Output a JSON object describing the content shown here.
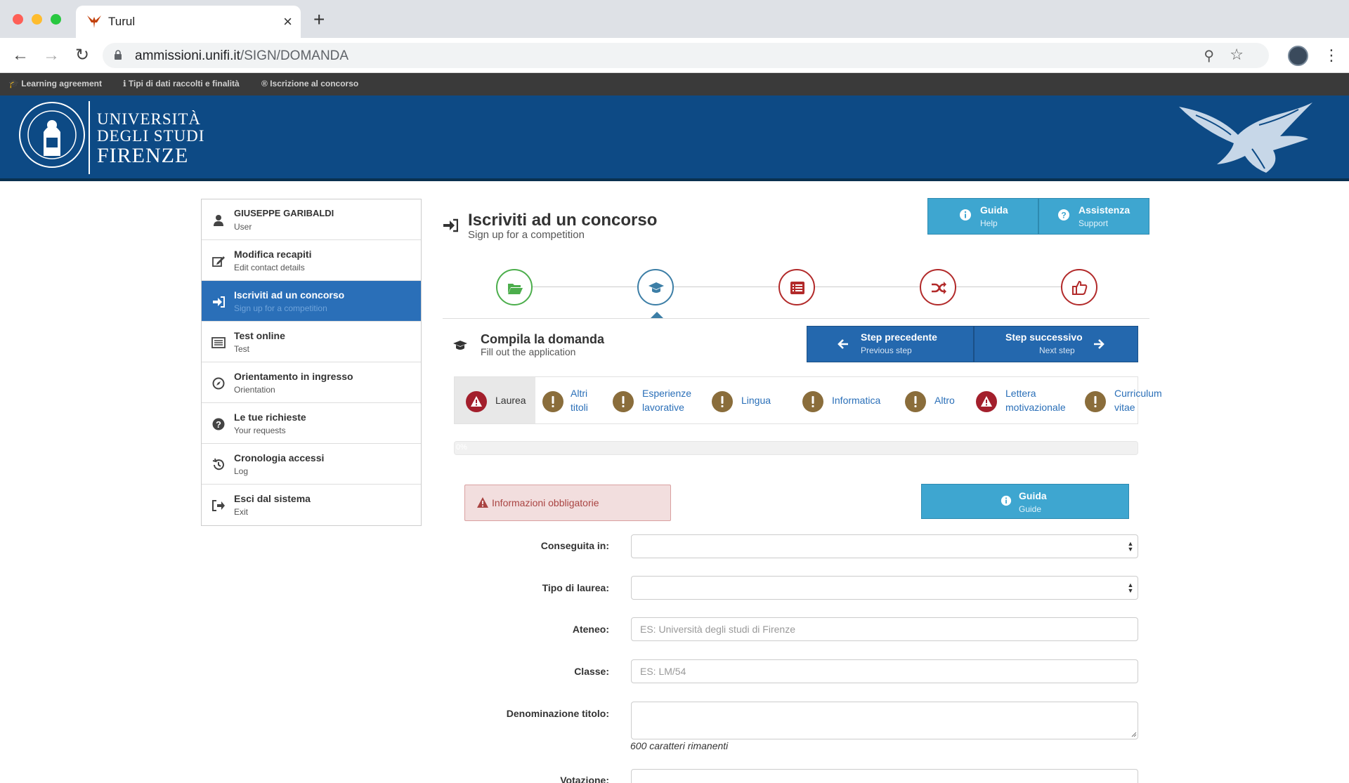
{
  "browser": {
    "tab_title": "Turul",
    "url_host": "ammissioni.unifi.it",
    "url_path": "/SIGN/DOMANDA"
  },
  "topbar": {
    "links": [
      "Learning agreement",
      "Tipi di dati raccolti e finalità",
      "Iscrizione al concorso"
    ]
  },
  "logo": {
    "line1": "UNIVERSITÀ",
    "line2": "DEGLI STUDI",
    "line3": "FIRENZE"
  },
  "sidebar": {
    "items": [
      {
        "title": "GIUSEPPE GARIBALDI",
        "sub": "User",
        "icon": "user-icon"
      },
      {
        "title": "Modifica recapiti",
        "sub": "Edit contact details",
        "icon": "edit-icon"
      },
      {
        "title": "Iscriviti ad un concorso",
        "sub": "Sign up for a competition",
        "icon": "sign-in-icon"
      },
      {
        "title": "Test online",
        "sub": "Test",
        "icon": "list-icon"
      },
      {
        "title": "Orientamento in ingresso",
        "sub": "Orientation",
        "icon": "compass-icon"
      },
      {
        "title": "Le tue richieste",
        "sub": "Your requests",
        "icon": "question-icon"
      },
      {
        "title": "Cronologia accessi",
        "sub": "Log",
        "icon": "history-icon"
      },
      {
        "title": "Esci dal sistema",
        "sub": "Exit",
        "icon": "sign-out-icon"
      }
    ]
  },
  "header": {
    "title": "Iscriviti ad un concorso",
    "subtitle": "Sign up for a competition",
    "help": {
      "title": "Guida",
      "sub": "Help"
    },
    "support": {
      "title": "Assistenza",
      "sub": "Support"
    }
  },
  "steps": [
    {
      "icon": "folder-open-icon",
      "color": "#4cae4c"
    },
    {
      "icon": "graduation-cap-icon",
      "color": "#3c7ea6"
    },
    {
      "icon": "list-icon",
      "color": "#b22a2a"
    },
    {
      "icon": "random-icon",
      "color": "#b22a2a"
    },
    {
      "icon": "thumbs-up-icon",
      "color": "#b22a2a"
    }
  ],
  "section": {
    "title": "Compila la domanda",
    "subtitle": "Fill out the application",
    "prev": {
      "title": "Step precedente",
      "sub": "Previous step"
    },
    "next": {
      "title": "Step successivo",
      "sub": "Next step"
    }
  },
  "subtabs": [
    {
      "line1": "Laurea",
      "line2": "",
      "status": "danger"
    },
    {
      "line1": "Altri",
      "line2": "titoli",
      "status": "warning"
    },
    {
      "line1": "Esperienze",
      "line2": "lavorative",
      "status": "warning"
    },
    {
      "line1": "Lingua",
      "line2": "",
      "status": "warning"
    },
    {
      "line1": "Informatica",
      "line2": "",
      "status": "warning"
    },
    {
      "line1": "Altro",
      "line2": "",
      "status": "warning"
    },
    {
      "line1": "Lettera",
      "line2": "motivazionale",
      "status": "danger"
    },
    {
      "line1": "Curriculum",
      "line2": "vitae",
      "status": "warning"
    }
  ],
  "progress": {
    "value": 0,
    "label": "0%"
  },
  "alert": {
    "text": "Informazioni obbligatorie"
  },
  "guide": {
    "title": "Guida",
    "sub": "Guide"
  },
  "form": {
    "conseguita_label": "Conseguita in:",
    "tipo_label": "Tipo di laurea:",
    "ateneo_label": "Ateneo:",
    "ateneo_placeholder": "ES: Università degli studi di Firenze",
    "classe_label": "Classe:",
    "classe_placeholder": "ES: LM/54",
    "denominazione_label": "Denominazione titolo:",
    "char_count": "600 caratteri rimanenti",
    "votazione_label": "Votazione:"
  },
  "colors": {
    "brand_blue": "#0d4a85",
    "danger": "#a31f2c",
    "warning": "#8a6d3b",
    "info": "#3ea6d0"
  }
}
